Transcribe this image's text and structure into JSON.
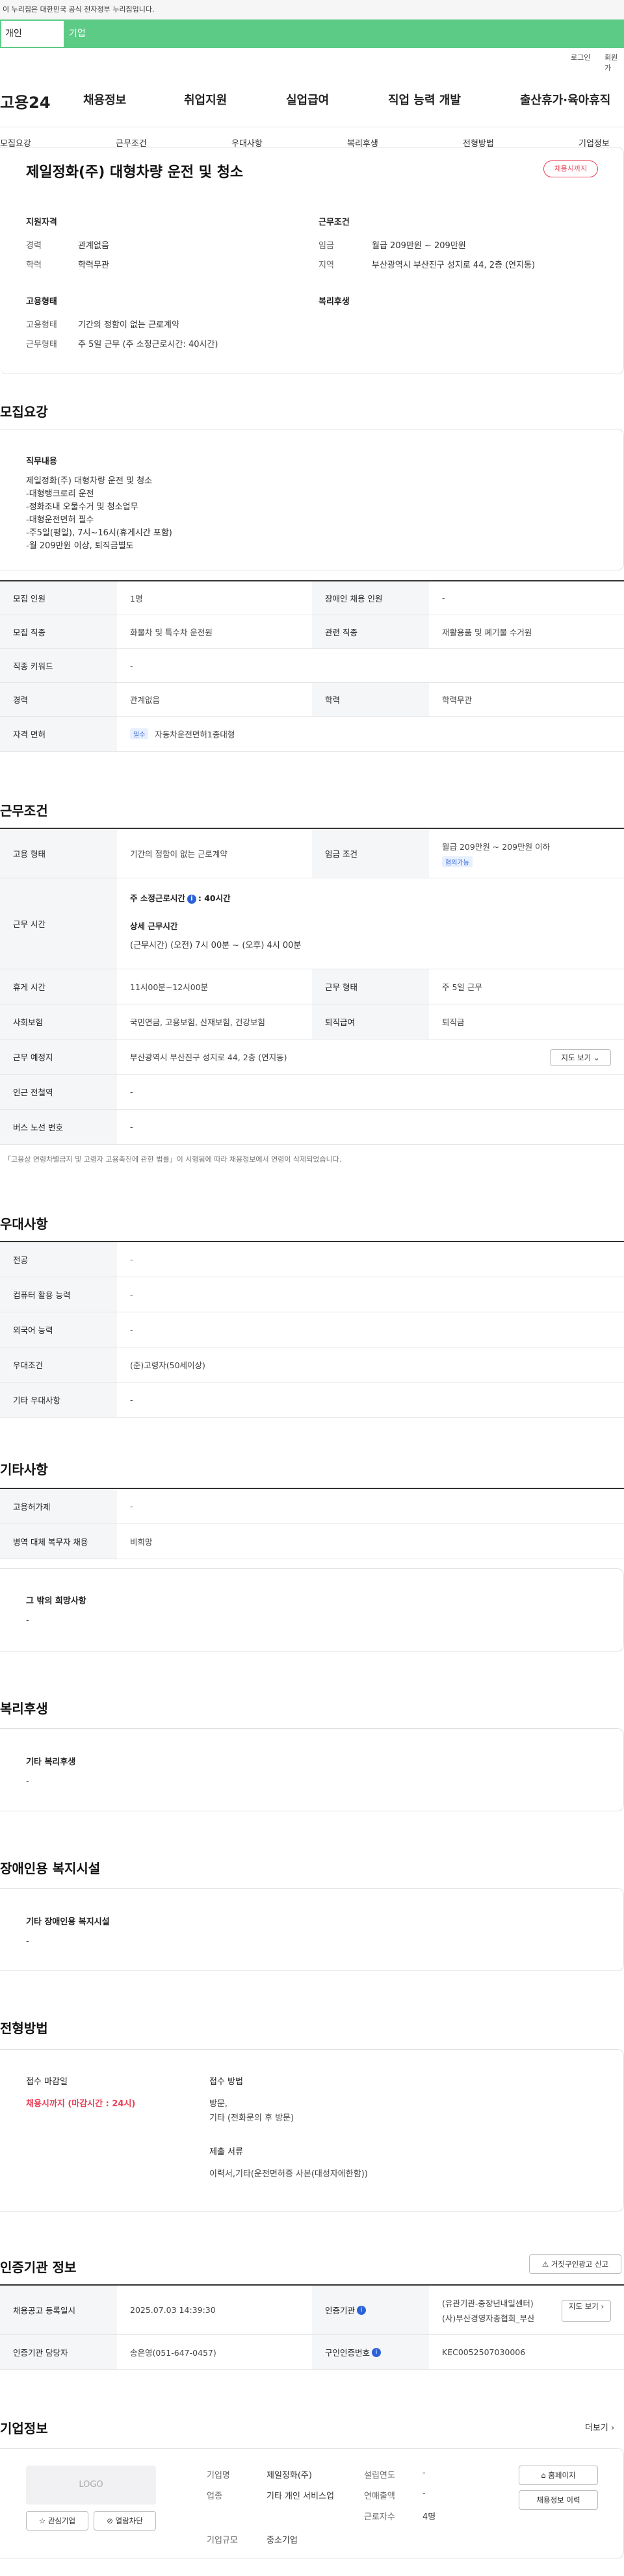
{
  "gov_banner": "이 누리집은 대한민국 공식 전자정부 누리집입니다.",
  "top_tabs": {
    "individual": "개인",
    "company": "기업"
  },
  "util": {
    "login": "로그인",
    "join": "회원가"
  },
  "logo": "고용24",
  "gnb": [
    "채용정보",
    "취업지원",
    "실업급여",
    "직업 능력 개발",
    "출산휴가·육아휴직"
  ],
  "lnb": [
    "모집요강",
    "근무조건",
    "우대사항",
    "복리후생",
    "전형방법",
    "기업정보"
  ],
  "summary": {
    "title": "제일정화(주) 대형차량 운전 및 청소",
    "status_badge": "채용시까지",
    "qual_title": "지원자격",
    "qual": [
      {
        "label": "경력",
        "value": "관계없음"
      },
      {
        "label": "학력",
        "value": "학력무관"
      }
    ],
    "cond_title": "근무조건",
    "cond": [
      {
        "label": "임금",
        "value": "월급 209만원 ~ 209만원"
      },
      {
        "label": "지역",
        "value": "부산광역시 부산진구 성지로 44, 2층 (연지동)"
      }
    ],
    "emp_title": "고용형태",
    "emp": [
      {
        "label": "고용형태",
        "value": "기간의 정함이 없는 근로계약"
      },
      {
        "label": "근무형태",
        "value": "주 5일 근무 (주 소정근로시간: 40시간)"
      }
    ],
    "welfare_title": "복리후생"
  },
  "recruit": {
    "section_title": "모집요강",
    "duty_title": "직무내용",
    "duty_lines": [
      "제일정화(주) 대형차량 운전 및 청소",
      "-대형탱크로리 운전",
      "-정화조내 오물수거 및 청소업무",
      "-대형운전면허 필수",
      "-주5일(평일), 7시~16시(휴게시간 포함)",
      "-월 209만원 이상, 퇴직금별도"
    ],
    "rows": [
      {
        "h1": "모집 인원",
        "v1": "1명",
        "h2": "장애인 채용 인원",
        "v2": "-"
      },
      {
        "h1": "모집 직종",
        "v1": "화물차 및 특수차 운전원",
        "h2": "관련 직종",
        "v2": "재활용품 및 폐기물 수거원"
      },
      {
        "h1": "직종 키워드",
        "v1": "-"
      },
      {
        "h1": "경력",
        "v1": "관계없음",
        "h2": "학력",
        "v2": "학력무관"
      },
      {
        "h1": "자격 면허",
        "badge": "필수",
        "v1": "자동차운전면허1종대형"
      }
    ]
  },
  "work": {
    "section_title": "근무조건",
    "employment_type_h": "고용 형태",
    "employment_type_v": "기간의 정함이 없는 근로계약",
    "wage_h": "임금 조건",
    "wage_v": "월급 209만원 ~ 209만원 이하",
    "wage_badge": "협의가능",
    "hours_h": "근무 시간",
    "hours_title": "주 소정근로시간",
    "hours_value": "40시간",
    "hours_detail_title": "상세 근무시간",
    "hours_detail": "(근무시간) (오전) 7시 00분 ~ (오후) 4시 00분",
    "rest_h": "휴게 시간",
    "rest_v": "11시00분~12시00분",
    "form_h": "근무 형태",
    "form_v": "주 5일 근무",
    "ins_h": "사회보험",
    "ins_v": "국민연금, 고용보험, 산재보험, 건강보험",
    "retire_h": "퇴직급여",
    "retire_v": "퇴직금",
    "place_h": "근무 예정지",
    "place_v": "부산광역시 부산진구 성지로 44, 2층 (연지동)",
    "map_btn": "지도 보기",
    "subway_h": "인근 전철역",
    "subway_v": "-",
    "bus_h": "버스 노선 번호",
    "bus_v": "-",
    "note": "「고용상 연령차별금지 및 고령자 고용촉진에 관한 법률」이 시행됨에 따라 채용정보에서 연령이 삭제되었습니다."
  },
  "pref": {
    "section_title": "우대사항",
    "rows": [
      {
        "h": "전공",
        "v": "-"
      },
      {
        "h": "컴퓨터 활용 능력",
        "v": "-"
      },
      {
        "h": "외국어 능력",
        "v": "-"
      },
      {
        "h": "우대조건",
        "v": "(준)고령자(50세이상)"
      },
      {
        "h": "기타 우대사항",
        "v": "-"
      }
    ]
  },
  "etc": {
    "section_title": "기타사항",
    "rows": [
      {
        "h": "고용허가제",
        "v": "-"
      },
      {
        "h": "병역 대체 복무자 채용",
        "v": "비희망"
      }
    ],
    "box_title": "그 밖의 희망사항",
    "box_value": "-"
  },
  "welfare": {
    "section_title": "복리후생",
    "box_title": "기타 복리후생",
    "box_value": "-"
  },
  "disabled": {
    "section_title": "장애인용 복지시설",
    "box_title": "기타 장애인용 복지시설",
    "box_value": "-"
  },
  "screening": {
    "section_title": "전형방법",
    "deadline_title": "접수 마감일",
    "deadline_value": "채용시까지 (마감시간 : 24시)",
    "method_title": "접수 방법",
    "method_lines": [
      "방문,",
      "기타 (전화문의 후 방문)"
    ],
    "docs_title": "제출 서류",
    "docs_value": "이력서,기타(운전면허증 사본(대성자에한함))"
  },
  "cert": {
    "section_title": "인증기관 정보",
    "report_btn": "거짓구인광고 신고",
    "reg_date_h": "채용공고 등록일시",
    "reg_date_v": "2025.07.03 14:39:30",
    "agency_h": "인증기관",
    "agency_v1": "(유관기관-중장년내일센터)",
    "agency_v2": "(사)부산경영자총협회_부산",
    "map_btn": "지도 보기",
    "manager_h": "인증기관 담당자",
    "manager_v": "송은영(051-647-0457)",
    "reqno_h": "구인인증번호",
    "reqno_v": "KEC0052507030006"
  },
  "company": {
    "section_title": "기업정보",
    "more": "더보기",
    "logo_placeholder": "LOGO",
    "interest_btn": "관심기업",
    "block_btn": "열람차단",
    "name_h": "기업명",
    "name_v": "제일정화(주)",
    "industry_h": "업종",
    "industry_v": "기타 개인 서비스업",
    "size_h": "기업규모",
    "size_v": "중소기업",
    "est_h": "설립연도",
    "est_v": "-",
    "sales_h": "연매출액",
    "sales_v": "-",
    "emp_h": "근로자수",
    "emp_v": "4명",
    "homepage_btn": "홈페이지",
    "history_btn": "채용정보 이력"
  }
}
